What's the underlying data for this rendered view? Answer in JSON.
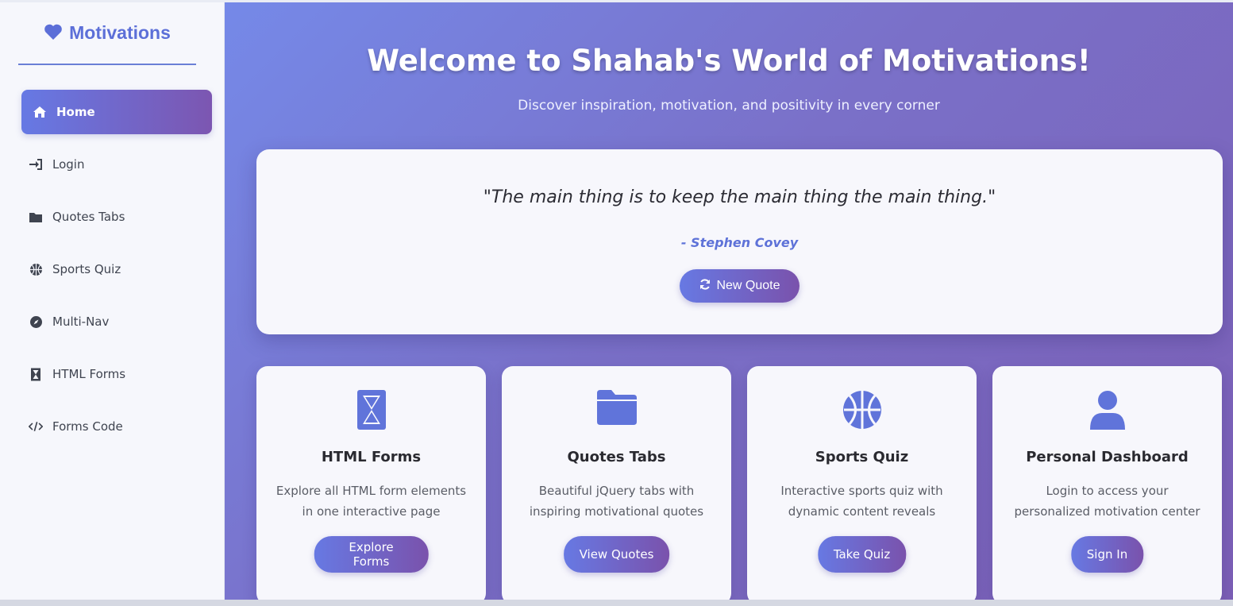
{
  "sidebar": {
    "brand": "Motivations",
    "items": [
      {
        "label": "Home",
        "icon": "home-icon",
        "active": true
      },
      {
        "label": "Login",
        "icon": "sign-in-icon"
      },
      {
        "label": "Quotes Tabs",
        "icon": "folder-icon"
      },
      {
        "label": "Sports Quiz",
        "icon": "basketball-icon"
      },
      {
        "label": "Multi-Nav",
        "icon": "compass-icon"
      },
      {
        "label": "HTML Forms",
        "icon": "hourglass-icon"
      },
      {
        "label": "Forms Code",
        "icon": "code-icon"
      }
    ]
  },
  "hero": {
    "title": "Welcome to Shahab's World of Motivations!",
    "subtitle": "Discover inspiration, motivation, and positivity in every corner"
  },
  "quote": {
    "text": "\"The main thing is to keep the main thing the main thing.\"",
    "author": "- Stephen Covey",
    "button": "New Quote"
  },
  "cards": [
    {
      "title": "HTML Forms",
      "desc": "Explore all HTML form elements in one interactive page",
      "button": "Explore Forms",
      "icon": "hourglass-icon"
    },
    {
      "title": "Quotes Tabs",
      "desc": "Beautiful jQuery tabs with inspiring motivational quotes",
      "button": "View Quotes",
      "icon": "folder-icon"
    },
    {
      "title": "Sports Quiz",
      "desc": "Interactive sports quiz with dynamic content reveals",
      "button": "Take Quiz",
      "icon": "basketball-icon"
    },
    {
      "title": "Personal Dashboard",
      "desc": "Login to access your personalized motivation center",
      "button": "Sign In",
      "icon": "user-icon"
    }
  ],
  "colors": {
    "accent": "#5c6fd8",
    "gradient_start": "#6679e4",
    "gradient_end": "#7c56b1"
  }
}
